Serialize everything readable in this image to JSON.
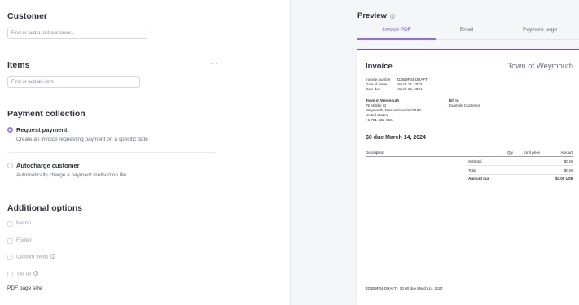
{
  "customer": {
    "title": "Customer",
    "placeholder": "Find or add a test customer..."
  },
  "items": {
    "title": "Items",
    "more": "···",
    "placeholder": "Find or add an item"
  },
  "payment_collection": {
    "title": "Payment collection",
    "options": [
      {
        "label": "Request payment",
        "description": "Create an invoice requesting payment on a specific date",
        "selected": true
      },
      {
        "label": "Autocharge customer",
        "description": "Automatically charge a payment method on file",
        "selected": false
      }
    ]
  },
  "additional_options": {
    "title": "Additional options",
    "checkboxes": [
      {
        "label": "Memo",
        "info": false
      },
      {
        "label": "Footer",
        "info": false
      },
      {
        "label": "Custom fields",
        "info": true
      },
      {
        "label": "Tax ID",
        "info": true
      }
    ],
    "pdf_page_size": "PDF page size"
  },
  "preview": {
    "title": "Preview",
    "tabs": [
      "Invoice PDF",
      "Email",
      "Payment page"
    ],
    "active_tab": 0
  },
  "invoice": {
    "title": "Invoice",
    "organization": "Town of Weymouth",
    "meta": {
      "number_label": "Invoice number",
      "number_value": "4D4B9F04-DRAFT",
      "issue_label": "Date of issue",
      "issue_value": "March 14, 2024",
      "due_label": "Date due",
      "due_value": "March 14, 2024"
    },
    "from": {
      "name": "Town of Weymouth",
      "lines": [
        "75 Middle St",
        "Weymouth, Massachusetts 02189",
        "United States",
        "+1 781-682-4334"
      ]
    },
    "bill_to": {
      "label": "Bill to",
      "name": "Example Customer"
    },
    "due_headline": "$0 due March 14, 2024",
    "table": {
      "headers": [
        "Description",
        "Qty",
        "Unit price",
        "Amount"
      ],
      "subtotal_label": "Subtotal",
      "subtotal_value": "$0.00",
      "total_label": "Total",
      "total_value": "$0.00",
      "amount_due_label": "Amount due",
      "amount_due_value": "$0.00 USD"
    },
    "footer": "4D4B9F04-DRAFT · $0.00 due March 14, 2024"
  }
}
